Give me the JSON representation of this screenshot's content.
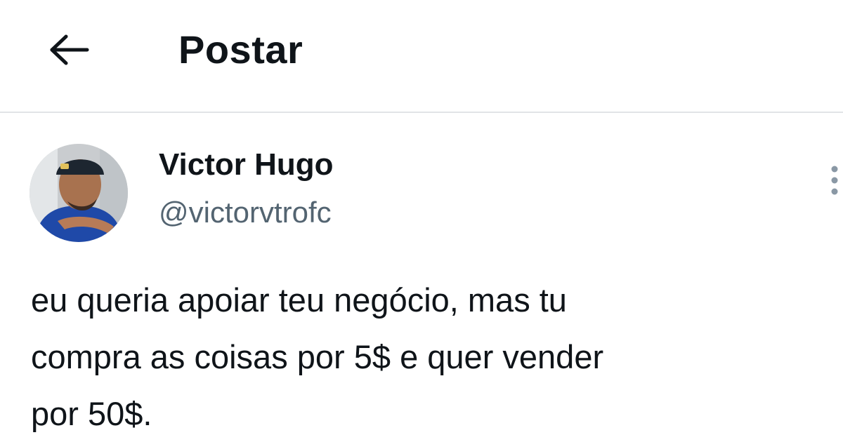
{
  "header": {
    "back_icon": "arrow-left-icon",
    "title": "Postar"
  },
  "post": {
    "author": {
      "display_name": "Victor Hugo",
      "handle": "@victorvtrofc",
      "avatar_icon": "profile-photo"
    },
    "more_icon": "more-vertical-icon",
    "text": "eu queria apoiar teu negócio, mas tu\ncompra as coisas por 5$ e quer vender\npor 50$."
  },
  "colors": {
    "text_primary": "#0f1419",
    "text_secondary": "#536471",
    "divider": "#e1e4e7"
  }
}
